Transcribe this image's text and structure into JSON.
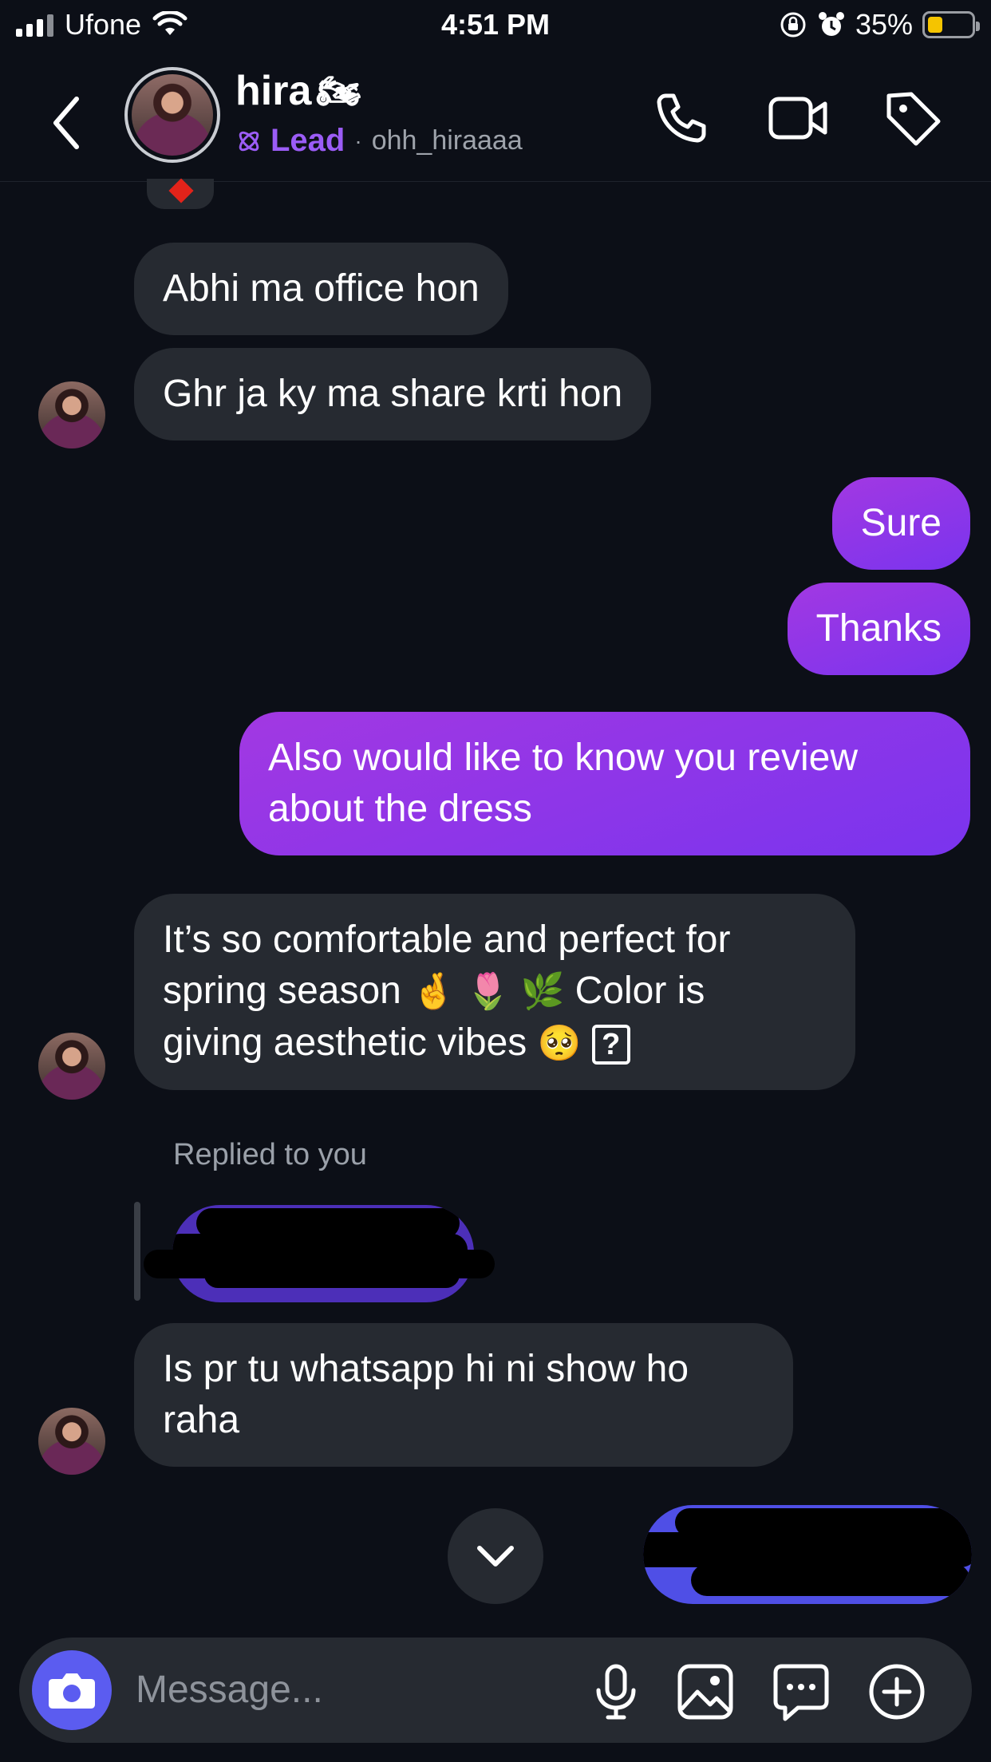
{
  "status_bar": {
    "carrier": "Ufone",
    "time": "4:51 PM",
    "battery": "35%",
    "battery_level": 0.35,
    "icons": [
      "signal-icon",
      "wifi-icon",
      "rotation-lock-icon",
      "alarm-icon",
      "battery-icon"
    ]
  },
  "header": {
    "name": "hira",
    "name_emoji": "🏍",
    "lead_label": "Lead",
    "separator": "·",
    "handle": "ohh_hiraaaa",
    "icons": [
      "back-icon",
      "phone-icon",
      "video-icon",
      "tag-icon"
    ]
  },
  "messages": [
    {
      "id": "m1",
      "direction": "incoming",
      "text": "Abhi ma office hon"
    },
    {
      "id": "m2",
      "direction": "incoming",
      "text": "Ghr ja ky ma share krti hon"
    },
    {
      "id": "m3",
      "direction": "outgoing",
      "text": "Sure"
    },
    {
      "id": "m4",
      "direction": "outgoing",
      "text": "Thanks"
    },
    {
      "id": "m5",
      "direction": "outgoing",
      "line1": "Also would like to know you review",
      "line2": "about the dress"
    },
    {
      "id": "m6",
      "direction": "incoming",
      "line1": "It’s so comfortable and perfect for",
      "line2a": "spring season",
      "emoji_a": "🤞",
      "emoji_b": "🌷",
      "emoji_c": "🌿",
      "line2b": "Color is",
      "line3": "giving aesthetic vibes",
      "emoji_d": "🥺",
      "unknown_glyph": "?"
    },
    {
      "id": "m7",
      "direction": "incoming",
      "line1": "Is pr tu whatsapp hi ni show ho",
      "line2": "raha"
    }
  ],
  "reply_note": "Replied to you",
  "composer": {
    "placeholder": "Message...",
    "icons": [
      "camera-icon",
      "microphone-icon",
      "gallery-icon",
      "sticker-icon",
      "plus-icon"
    ]
  },
  "colors": {
    "background": "#0c0f17",
    "incoming_bubble": "#262a31",
    "outgoing_bubble": "#8a2fe6",
    "lead_accent": "#9b5cf6",
    "camera_button": "#5b5cf0"
  }
}
